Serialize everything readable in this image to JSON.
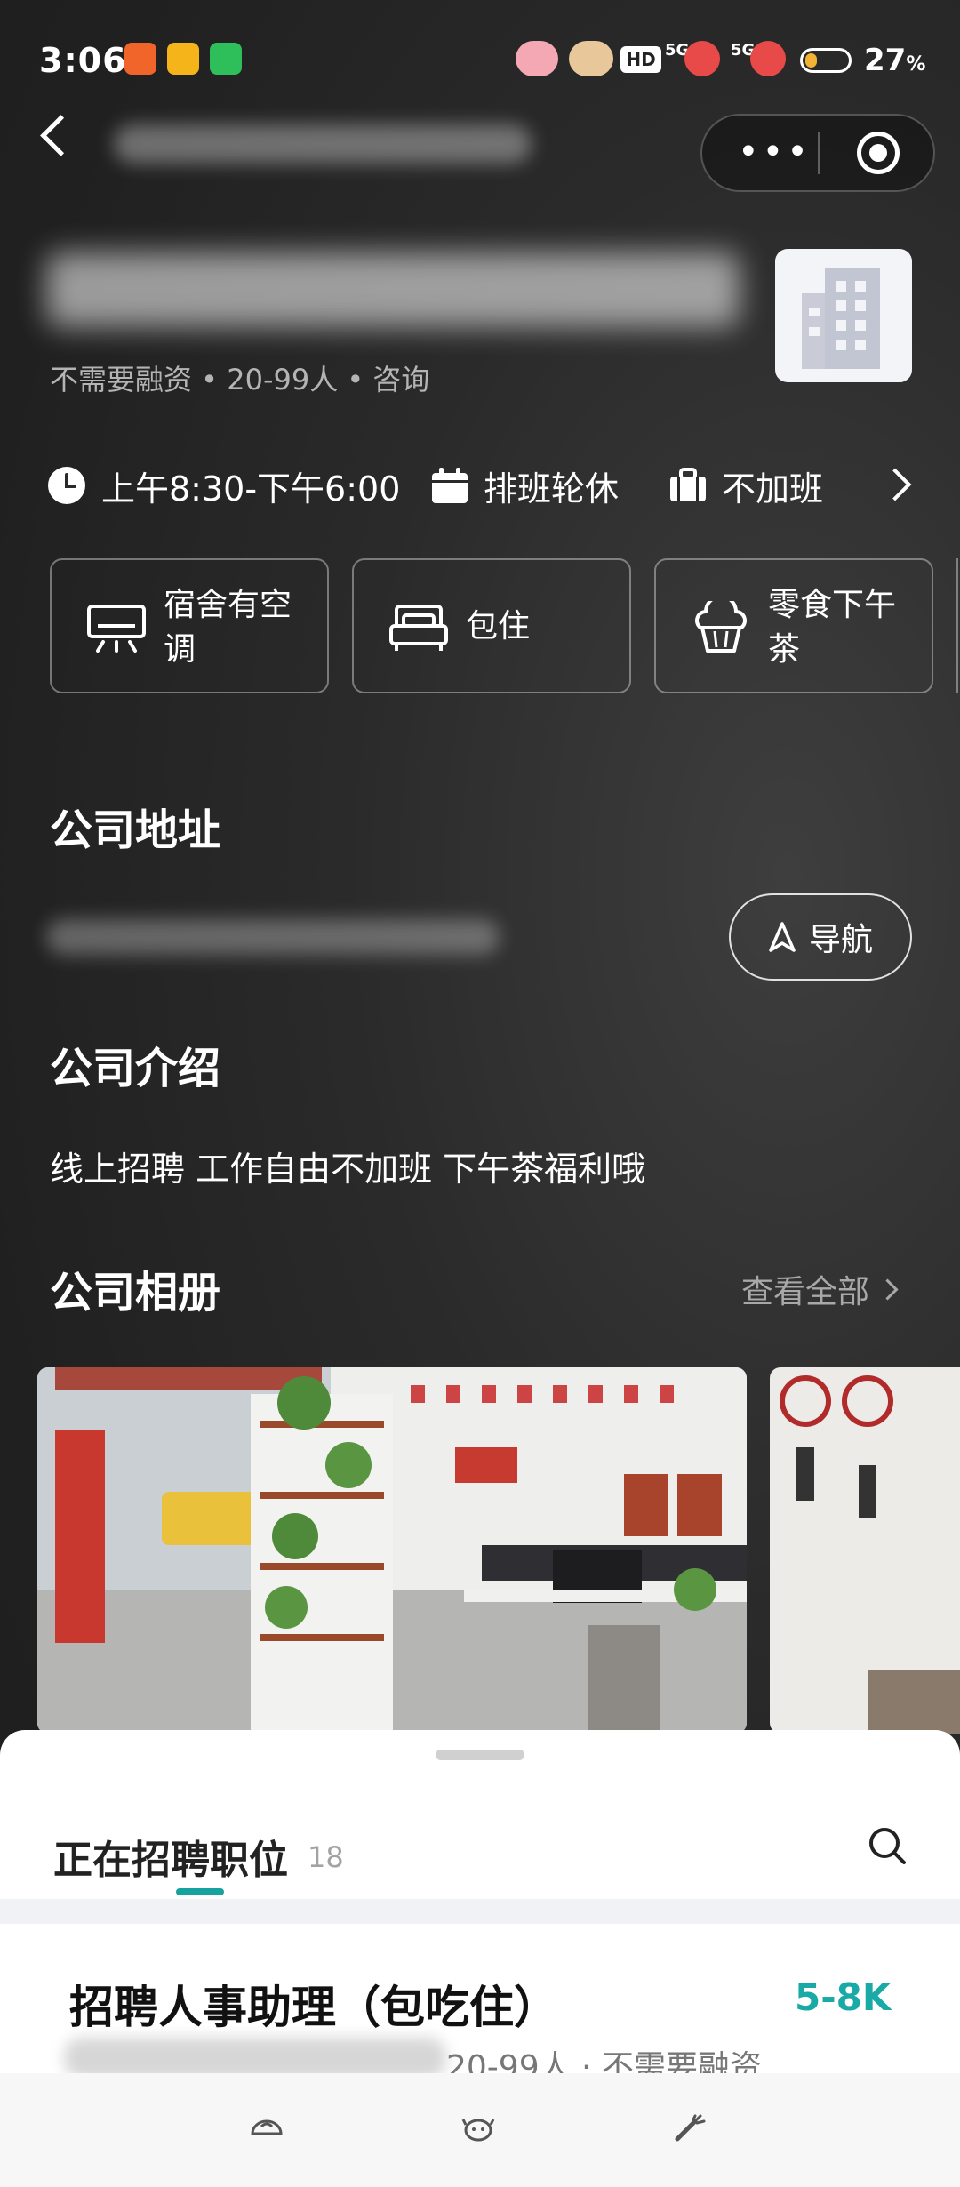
{
  "status_bar": {
    "time": "3:06",
    "network": "5G",
    "hd_label": "HD",
    "battery_percent": 27,
    "battery_text": "27",
    "battery_unit": "%"
  },
  "company": {
    "meta": "不需要融资 • 20-99人 • 咨询"
  },
  "tags": [
    {
      "label": "上午8:30-下午6:00",
      "icon": "clock-icon"
    },
    {
      "label": "排班轮休",
      "icon": "calendar-icon"
    },
    {
      "label": "不加班",
      "icon": "briefcase-icon"
    }
  ],
  "benefits": [
    {
      "label": "宿舍有空调",
      "icon": "air-conditioner-icon"
    },
    {
      "label": "包住",
      "icon": "bed-icon"
    },
    {
      "label": "零食下午茶",
      "icon": "cupcake-icon"
    }
  ],
  "sections": {
    "address_title": "公司地址",
    "navigate_label": "导航",
    "intro_title": "公司介绍",
    "intro_text": "线上招聘 工作自由不加班 下午茶福利哦",
    "album_title": "公司相册",
    "view_all_label": "查看全部"
  },
  "jobs": {
    "title": "正在招聘职位",
    "count": "18",
    "first": {
      "title": "招聘人事助理（包吃住）",
      "salary": "5-8K",
      "meta": "20-99人 · 不需要融资"
    }
  },
  "colors": {
    "accent": "#19a9a7",
    "background": "#2b2b2b",
    "sheet": "#ffffff"
  }
}
